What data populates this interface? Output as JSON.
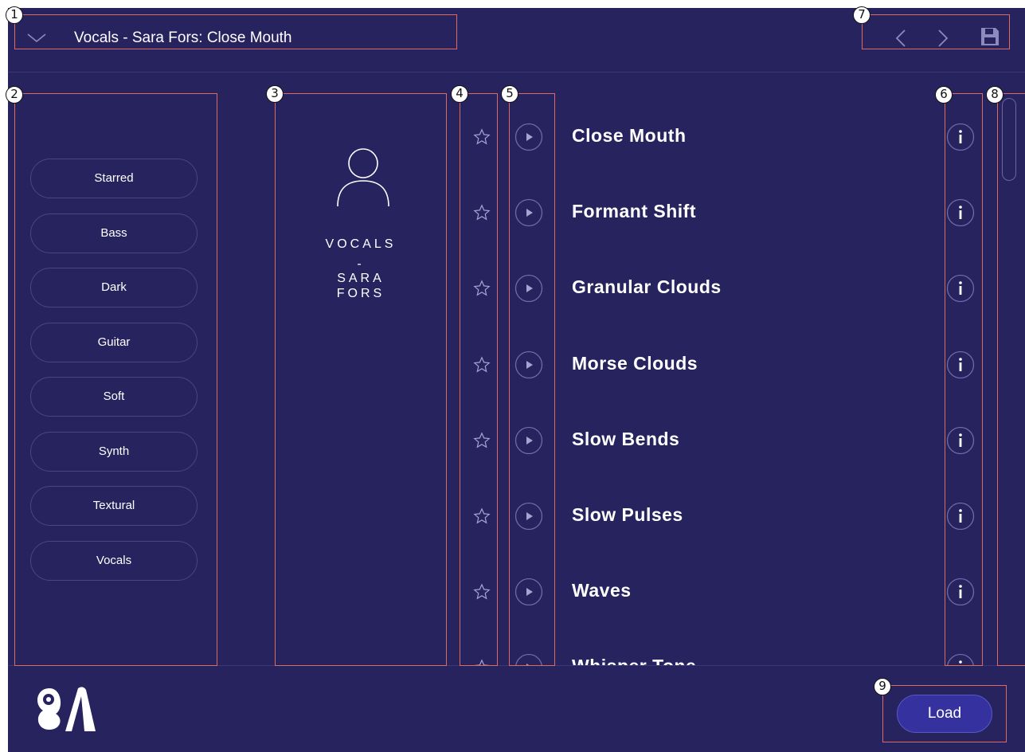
{
  "header": {
    "preset_title": "Vocals - Sara Fors: Close Mouth"
  },
  "categories": [
    "Starred",
    "Bass",
    "Dark",
    "Guitar",
    "Soft",
    "Synth",
    "Textural",
    "Vocals"
  ],
  "bank": {
    "name_line1": "VOCALS",
    "name_line2": "-",
    "name_line3": "SARA",
    "name_line4": "FORS"
  },
  "presets": [
    "Close Mouth",
    "Formant Shift",
    "Granular Clouds",
    "Morse Clouds",
    "Slow Bends",
    "Slow Pulses",
    "Waves",
    "Whisper Tone"
  ],
  "footer": {
    "load_label": "Load"
  },
  "annotations": [
    "1",
    "2",
    "3",
    "4",
    "5",
    "6",
    "7",
    "8",
    "9"
  ],
  "colors": {
    "background": "#27235f",
    "annotation": "#e0685f",
    "load_button": "#3532a0"
  },
  "icons": [
    "chevron-down-icon",
    "chevron-left-icon",
    "chevron-right-icon",
    "save-icon",
    "user-icon",
    "star-icon",
    "play-icon",
    "info-icon",
    "logo-icon"
  ]
}
